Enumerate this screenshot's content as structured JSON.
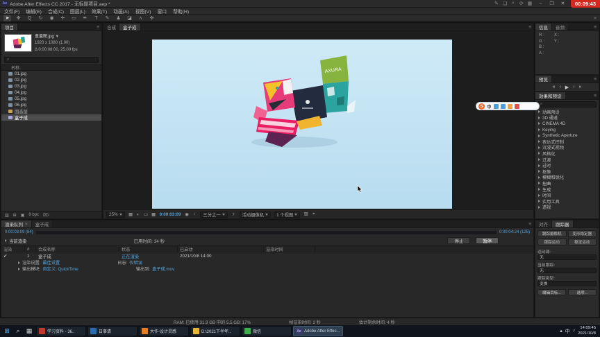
{
  "colors": {
    "accent_blue": "#58a6dc",
    "progress_blue": "#2f66a8",
    "record_red": "#d5281e"
  },
  "recorder": {
    "time": "00:09:43"
  },
  "titlebar": {
    "app_icon": "Ae",
    "title": "Adobe After Effects CC 2017 - 无标题项目.aep *",
    "icons": [
      {
        "name": "annotate-pencil-icon",
        "glyph": "✎"
      },
      {
        "name": "screenshot-icon",
        "glyph": "❏"
      },
      {
        "name": "magnifier-icon",
        "glyph": "⌕"
      },
      {
        "name": "refresh-icon",
        "glyph": "⟳"
      },
      {
        "name": "layout-icon",
        "glyph": "▦"
      }
    ],
    "minimize": "–",
    "maximize": "❐",
    "close": "✕"
  },
  "menubar": {
    "items": [
      "文件(F)",
      "编辑(E)",
      "合成(C)",
      "图层(L)",
      "效果(T)",
      "动画(A)",
      "视图(V)",
      "窗口",
      "帮助(H)"
    ]
  },
  "toolbar": {
    "tools": [
      {
        "name": "selection-tool",
        "glyph": "➤"
      },
      {
        "name": "hand-tool",
        "glyph": "✥"
      },
      {
        "name": "zoom-tool",
        "glyph": "Q"
      },
      {
        "name": "rotate-tool",
        "glyph": "↻"
      },
      {
        "name": "unified-camera-tool",
        "glyph": "◉"
      },
      {
        "name": "pan-behind-tool",
        "glyph": "✛"
      },
      {
        "name": "shape-tool",
        "glyph": "▭"
      },
      {
        "name": "pen-tool",
        "glyph": "✒"
      },
      {
        "name": "type-tool",
        "glyph": "T"
      },
      {
        "name": "brush-tool",
        "glyph": "✎"
      },
      {
        "name": "clone-stamp-tool",
        "glyph": "♟"
      },
      {
        "name": "eraser-tool",
        "glyph": "◪"
      },
      {
        "name": "roto-brush-tool",
        "glyph": "ʌ"
      },
      {
        "name": "puppet-pin-tool",
        "glyph": "✜"
      }
    ],
    "overflow": "»"
  },
  "project": {
    "tab": "项目",
    "preview": {
      "name": "盒盖图.jpg",
      "menu": "▼",
      "dims": "1920 x 1080 (1.00)",
      "time": "Δ 0:00:08:00, 25.00 fps"
    },
    "search_icon": "⌕",
    "name_header": "名称",
    "items": [
      {
        "label": "01.jpg",
        "kind": "footage"
      },
      {
        "label": "02.jpg",
        "kind": "footage"
      },
      {
        "label": "03.jpg",
        "kind": "footage"
      },
      {
        "label": "04.jpg",
        "kind": "footage"
      },
      {
        "label": "05.jpg",
        "kind": "footage"
      },
      {
        "label": "06.jpg",
        "kind": "footage"
      },
      {
        "label": "固态层",
        "kind": "folder"
      },
      {
        "label": "盒子成",
        "kind": "comp",
        "selected": true
      }
    ],
    "footer_icons": [
      {
        "name": "interpret-footage-icon",
        "glyph": "▥"
      },
      {
        "name": "new-folder-icon",
        "glyph": "⊞"
      },
      {
        "name": "new-composition-icon",
        "glyph": "▣"
      },
      {
        "name": "project-bit-depth",
        "glyph": "8 bpc"
      },
      {
        "name": "delete-icon",
        "glyph": "⌦"
      }
    ]
  },
  "viewer": {
    "panel_label": "合成",
    "tab": "盒子成",
    "box_text": "AXURA",
    "bottom": {
      "zoom": "25%",
      "icons_a": [
        {
          "name": "grid-guides-icon",
          "glyph": "▦"
        },
        {
          "name": "mask-visibility-icon",
          "glyph": "◐"
        },
        {
          "name": "region-of-interest-icon",
          "glyph": "▭"
        },
        {
          "name": "transparency-grid-icon",
          "glyph": "▩"
        }
      ],
      "timecode": "0:00:03:09",
      "icons_b": [
        {
          "name": "snapshot-icon",
          "glyph": "◉"
        },
        {
          "name": "show-channel-icon",
          "glyph": "◔"
        }
      ],
      "resolution": "三分之一",
      "fast_preview_icon": "⚡",
      "camera": "活动摄像机",
      "views": "1 个视图",
      "icons_c": [
        {
          "name": "view-layout-icon",
          "glyph": "▥"
        },
        {
          "name": "pixel-aspect-icon",
          "glyph": "⌖"
        }
      ]
    }
  },
  "info": {
    "tab_info": "信息",
    "tab_audio": "音频",
    "channels": [
      "R :",
      "G :",
      "B :",
      "A :"
    ],
    "coords": [
      "X :",
      "Y :"
    ]
  },
  "preview_panel": {
    "tab": "预览",
    "buttons": [
      {
        "name": "first-frame-button",
        "glyph": "«"
      },
      {
        "name": "previous-frame-button",
        "glyph": "‹"
      },
      {
        "name": "play-button",
        "glyph": "▶"
      },
      {
        "name": "next-frame-button",
        "glyph": "›"
      },
      {
        "name": "last-frame-button",
        "glyph": "»"
      }
    ]
  },
  "effects": {
    "tab": "效果和预设",
    "search_icon": "⌕",
    "categories": [
      "动画预设",
      "3D 通道",
      "CINEMA 4D",
      "Keying",
      "Synthetic Aperture",
      "表达式控制",
      "沉浸式视频",
      "风格化",
      "过渡",
      "过时",
      "抠像",
      "模糊和锐化",
      "扭曲",
      "生成",
      "时间",
      "实用工具",
      "透视"
    ]
  },
  "sogou": {
    "brand": "S",
    "lang": "中",
    "icons": [
      {
        "name": "voice-icon",
        "color": "#48a0dc"
      },
      {
        "name": "keyboard-icon",
        "color": "#48a0dc"
      },
      {
        "name": "emoji-icon",
        "color": "#f0a03c"
      },
      {
        "name": "toolbox-icon",
        "color": "#e05050"
      }
    ]
  },
  "render_queue": {
    "tab_queue": "渲染队列",
    "tab_close": "×",
    "tab_comp": "盒子成",
    "progress": {
      "pct": 67,
      "left": "0:00:03:09 (84)",
      "right": "0:00:04:24 (125)"
    },
    "current_label": "当前渲染",
    "elapsed_label": "已用时间:",
    "elapsed": "34 秒",
    "stop": "停止",
    "pause": "暂停",
    "columns": [
      "渲染",
      "#",
      "合成名称",
      "状态",
      "已启动",
      "渲染时间"
    ],
    "row": {
      "check": "✔",
      "num": "1",
      "name": "盒子成",
      "status": "正在渲染",
      "started": "2021/10/8 14:00",
      "rtime": ""
    },
    "details": [
      {
        "label": "渲染设置:",
        "value": "最佳设置",
        "label2": "日志:",
        "value2": "仅错误"
      },
      {
        "label": "输出模块:",
        "value": "自定义: QuickTime",
        "label2": "输出到:",
        "value2": "盒子成.mov"
      }
    ]
  },
  "tracker": {
    "tab_align": "对齐",
    "tab_tracker": "跟踪器",
    "buttons": [
      "跟踪摄像机",
      "变形稳定器",
      "跟踪运动",
      "稳定运动"
    ],
    "fields": [
      {
        "label": "运动源:",
        "value": "无"
      },
      {
        "label": "当前跟踪:",
        "value": "无"
      },
      {
        "label": "跟踪类型:",
        "value": "变换"
      }
    ],
    "footer_buttons": [
      "编辑目标...",
      "选项..."
    ]
  },
  "statusbar": {
    "ram": "RAM: 已使用 31.9 GB 中的 5.5 GB: 17%",
    "frame_time": "帧渲染时间: 2 秒",
    "remaining": "估计剩余时间: 4 秒"
  },
  "taskbar": {
    "start_icons": [
      {
        "name": "start-button",
        "glyph": "⊞",
        "color": "#58b0f0"
      },
      {
        "name": "search-icon",
        "glyph": "⌕",
        "color": "#cfcfcf"
      },
      {
        "name": "task-view-icon",
        "glyph": "▦",
        "color": "#cfcfcf"
      }
    ],
    "items": [
      {
        "label": "学习资料 - 36..",
        "color": "#c0392b",
        "badge": "",
        "active": false
      },
      {
        "label": "日事清",
        "color": "#2b6cb0",
        "badge": "",
        "active": false
      },
      {
        "label": "大作-设计灵感",
        "color": "#e67e22",
        "badge": "",
        "active": false
      },
      {
        "label": "D:\\2021下半年..",
        "color": "#e8b339",
        "badge": "",
        "active": false
      },
      {
        "label": "微信",
        "color": "#3faf50",
        "badge": "",
        "active": false
      },
      {
        "label": "Adobe After Effec...",
        "color": "#3b3b6e",
        "badge": "Ae",
        "active": true
      }
    ],
    "tray": {
      "icons": [
        {
          "name": "tray-expand-icon",
          "glyph": "▴"
        },
        {
          "name": "ime-icon",
          "glyph": "中"
        },
        {
          "name": "volume-icon",
          "glyph": "♪"
        }
      ],
      "time": "14:09:45",
      "date": "2021/10/8"
    }
  }
}
